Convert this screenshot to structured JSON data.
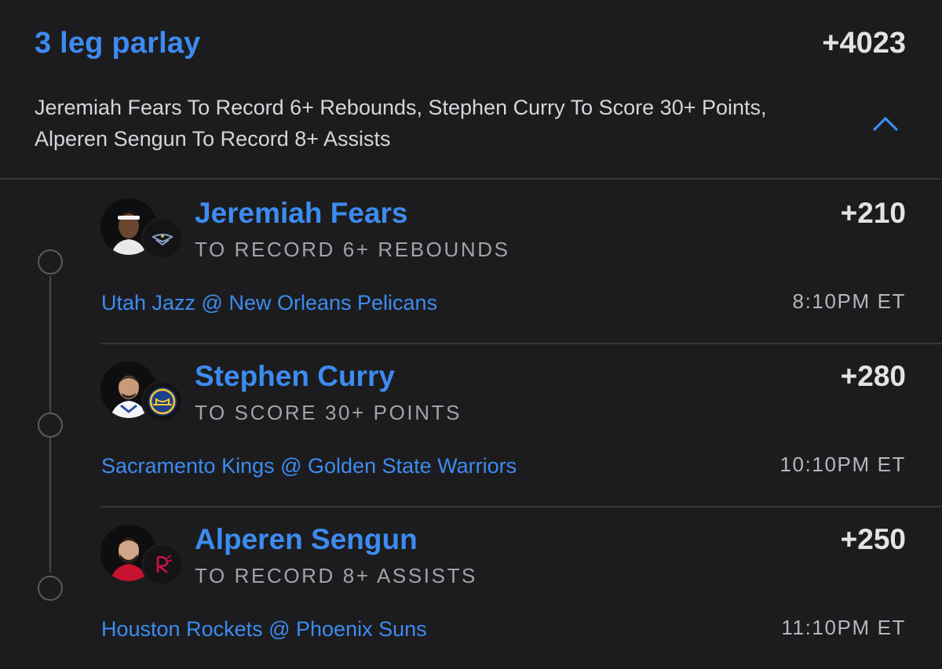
{
  "parlay": {
    "title": "3 leg parlay",
    "odds": "+4023",
    "summary": "Jeremiah Fears To Record 6+ Rebounds, Stephen Curry To Score 30+ Points, Alperen Sengun To Record 8+ Assists",
    "collapse_icon": "chevron-up-icon"
  },
  "colors": {
    "accent": "#3d8bf0",
    "background": "#1c1c1e",
    "odds_text": "#e3e3e6",
    "muted_text": "#a2a2a8",
    "divider": "#38383c"
  },
  "legs": [
    {
      "player": "Jeremiah Fears",
      "odds": "+210",
      "market": "TO RECORD 6+ REBOUNDS",
      "matchup": "Utah Jazz @ New Orleans Pelicans",
      "time": "8:10PM ET",
      "team_logo_icon": "pelicans-logo-icon"
    },
    {
      "player": "Stephen Curry",
      "odds": "+280",
      "market": "TO SCORE 30+ POINTS",
      "matchup": "Sacramento Kings @ Golden State Warriors",
      "time": "10:10PM ET",
      "team_logo_icon": "warriors-logo-icon"
    },
    {
      "player": "Alperen Sengun",
      "odds": "+250",
      "market": "TO RECORD 8+ ASSISTS",
      "matchup": "Houston Rockets @ Phoenix Suns",
      "time": "11:10PM ET",
      "team_logo_icon": "rockets-logo-icon"
    }
  ]
}
